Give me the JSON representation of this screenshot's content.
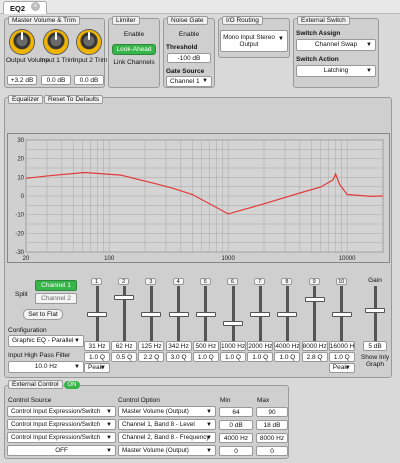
{
  "tab": {
    "label": "EQ2"
  },
  "master": {
    "title": "Master Volume & Trim",
    "knobs": [
      {
        "label": "Output Volume",
        "value": "+3.2 dB"
      },
      {
        "label": "Input 1 Trim",
        "value": "0.0 dB"
      },
      {
        "label": "Input 2 Trim",
        "value": "0.0 dB"
      }
    ]
  },
  "limiter": {
    "title": "Limiter",
    "enable": "Enable",
    "lookahead": "Look-Ahead",
    "link": "Link Channels"
  },
  "gate": {
    "title": "Noise Gate",
    "enable": "Enable",
    "threshold_label": "Threshold",
    "threshold": "-100 dB",
    "source_label": "Gate Source",
    "source": "Channel 1"
  },
  "io": {
    "title": "I/O Routing",
    "mode": "Mono Input Stereo Output"
  },
  "extswitch": {
    "title": "External Switch",
    "assign_label": "Switch Assign",
    "assign": "Channel Swap",
    "action_label": "Switch Action",
    "action": "Latching"
  },
  "eq": {
    "title": "Equalizer",
    "reset": "Reset To Defaults"
  },
  "chart_data": {
    "type": "line",
    "x_scale": "log",
    "xlim": [
      20,
      20000
    ],
    "ylim": [
      -30,
      30
    ],
    "yticks": [
      30,
      20,
      10,
      0,
      -10,
      -20,
      -30
    ],
    "xticks": [
      {
        "v": 20,
        "l": "20"
      },
      {
        "v": 100,
        "l": "100"
      },
      {
        "v": 1000,
        "l": "1000"
      },
      {
        "v": 10000,
        "l": "10000"
      }
    ],
    "grid": true,
    "series": [
      {
        "color": "#e23a3a",
        "x": [
          20,
          31,
          62,
          125,
          250,
          342,
          500,
          1000,
          2000,
          4000,
          6000,
          7600,
          8000,
          8600,
          10000,
          16000,
          20000
        ],
        "y": [
          9.5,
          10.8,
          12.6,
          11.2,
          6.5,
          4.2,
          0.8,
          -9.6,
          -4.2,
          1.6,
          4.8,
          8.6,
          11.8,
          6.4,
          0.8,
          -0.2,
          0.0
        ]
      }
    ]
  },
  "controls": {
    "split": "Split",
    "channel1": "Channel 1",
    "channel2": "Channel 2",
    "flat": "Set to Flat",
    "config_label": "Configuration",
    "config": "Graphic EQ - Parallel",
    "hpf_label": "Input High Pass Filter",
    "hpf": "10.0 Hz",
    "gain": "Gain",
    "gain_value": "5 dB",
    "show_graph": "Show Inly Graph"
  },
  "bands": [
    {
      "n": "1",
      "f": "31 Hz",
      "q": "1.0 Q",
      "filter": "Peak",
      "level": 0.5
    },
    {
      "n": "2",
      "f": "62 Hz",
      "q": "0.5 Q",
      "level": 0.83
    },
    {
      "n": "3",
      "f": "125 Hz",
      "q": "2.2 Q",
      "level": 0.5
    },
    {
      "n": "4",
      "f": "342 Hz",
      "q": "3.0 Q",
      "level": 0.5
    },
    {
      "n": "5",
      "f": "500 Hz",
      "q": "1.0 Q",
      "level": 0.5
    },
    {
      "n": "6",
      "f": "1000 Hz",
      "q": "1.0 Q",
      "level": 0.33
    },
    {
      "n": "7",
      "f": "2000 Hz",
      "q": "1.0 Q",
      "level": 0.5
    },
    {
      "n": "8",
      "f": "4000 Hz",
      "q": "1.0 Q",
      "level": 0.5
    },
    {
      "n": "9",
      "f": "8000 Hz",
      "q": "2.8 Q",
      "level": 0.78
    },
    {
      "n": "10",
      "f": "16000 Hz",
      "q": "1.0 Q",
      "filter": "Peak",
      "level": 0.5
    }
  ],
  "master_fader_level": 0.58,
  "ext_control": {
    "title": "External Control",
    "toggle": "ON",
    "source_label": "Control Source",
    "option_label": "Control Option",
    "min_label": "Min",
    "max_label": "Max",
    "rows": [
      {
        "source": "Control Input Expression/Switch",
        "option": "Master Volume (Output)",
        "min": "64",
        "max": "90"
      },
      {
        "source": "Control Input Expression/Switch",
        "option": "Channel 1, Band 8 - Level",
        "min": "0 dB",
        "max": "18 dB"
      },
      {
        "source": "Control Input Expression/Switch",
        "option": "Channel 2, Band 8 - Frequency",
        "min": "4000 Hz",
        "max": "8000 Hz"
      },
      {
        "source": "OFF",
        "option": "Master Volume (Output)",
        "min": "0",
        "max": "0"
      }
    ]
  }
}
